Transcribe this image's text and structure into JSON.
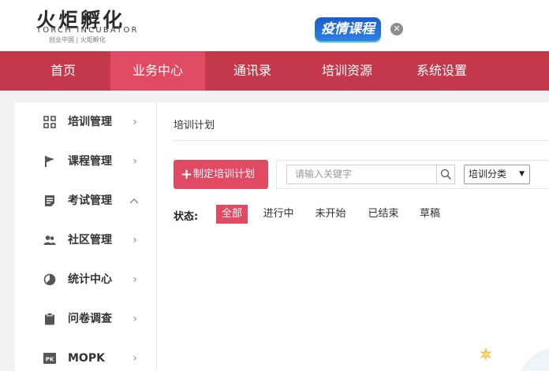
{
  "logo": {
    "name_cn": "火炬孵化",
    "name_en": "TORCH INCUBATOR",
    "tagline": "创业中国 | 火炬孵化"
  },
  "promo": {
    "label": "疫情课程",
    "close_glyph": "✕"
  },
  "topnav": {
    "items": [
      {
        "label": "首页",
        "active": false
      },
      {
        "label": "业务中心",
        "active": true
      },
      {
        "label": "通讯录",
        "active": false
      },
      {
        "label": "培训资源",
        "active": false
      },
      {
        "label": "系统设置",
        "active": false
      }
    ]
  },
  "sidebar": {
    "items": [
      {
        "label": "培训管理",
        "icon": "grid-icon",
        "expanded": false
      },
      {
        "label": "课程管理",
        "icon": "flag-icon",
        "expanded": false
      },
      {
        "label": "考试管理",
        "icon": "document-icon",
        "expanded": true
      },
      {
        "label": "社区管理",
        "icon": "users-icon",
        "expanded": false
      },
      {
        "label": "统计中心",
        "icon": "pie-chart-icon",
        "expanded": false
      },
      {
        "label": "问卷调查",
        "icon": "clipboard-icon",
        "expanded": false
      },
      {
        "label": "MOPK",
        "icon": "pk-badge-icon",
        "expanded": false
      }
    ],
    "chevron_collapsed": "›",
    "chevron_expanded": "‹"
  },
  "content": {
    "breadcrumb": "培训计划",
    "create_button": "制定培训计划",
    "create_plus": "+",
    "search_placeholder": "请输入关键字",
    "category_select": {
      "selected": "培训分类",
      "caret": "▼"
    },
    "status_label": "状态:",
    "status_tabs": [
      {
        "label": "全部",
        "active": true
      },
      {
        "label": "进行中",
        "active": false
      },
      {
        "label": "未开始",
        "active": false
      },
      {
        "label": "已结束",
        "active": false
      },
      {
        "label": "草稿",
        "active": false
      }
    ]
  },
  "colors": {
    "nav_bg": "#c4384b",
    "accent": "#e04a63",
    "promo_blue": "#1b5fc9"
  }
}
